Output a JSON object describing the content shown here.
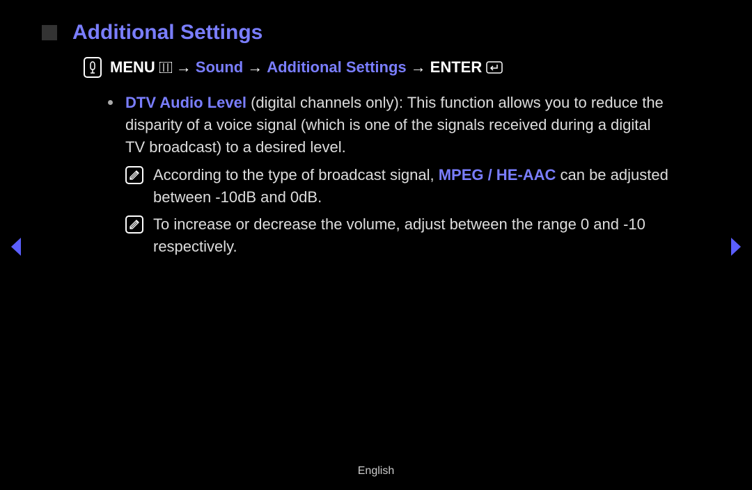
{
  "title": "Additional Settings",
  "breadcrumb": {
    "menu": "MENU",
    "arrow1": "→",
    "sound": "Sound",
    "arrow2": "→",
    "additional": "Additional Settings",
    "arrow3": "→",
    "enter": "ENTER"
  },
  "item": {
    "label": "DTV Audio Level",
    "desc_part1": " (digital channels only): This function allows you to reduce the disparity of a voice signal (which is one of the signals received during a digital TV broadcast) to a desired level."
  },
  "note1": {
    "pre": "According to the type of broadcast signal, ",
    "bold": "MPEG / HE-AAC",
    "post": " can be adjusted between -10dB and 0dB."
  },
  "note2": {
    "text": "To increase or decrease the volume, adjust between the range 0 and -10 respectively."
  },
  "footer": "English"
}
